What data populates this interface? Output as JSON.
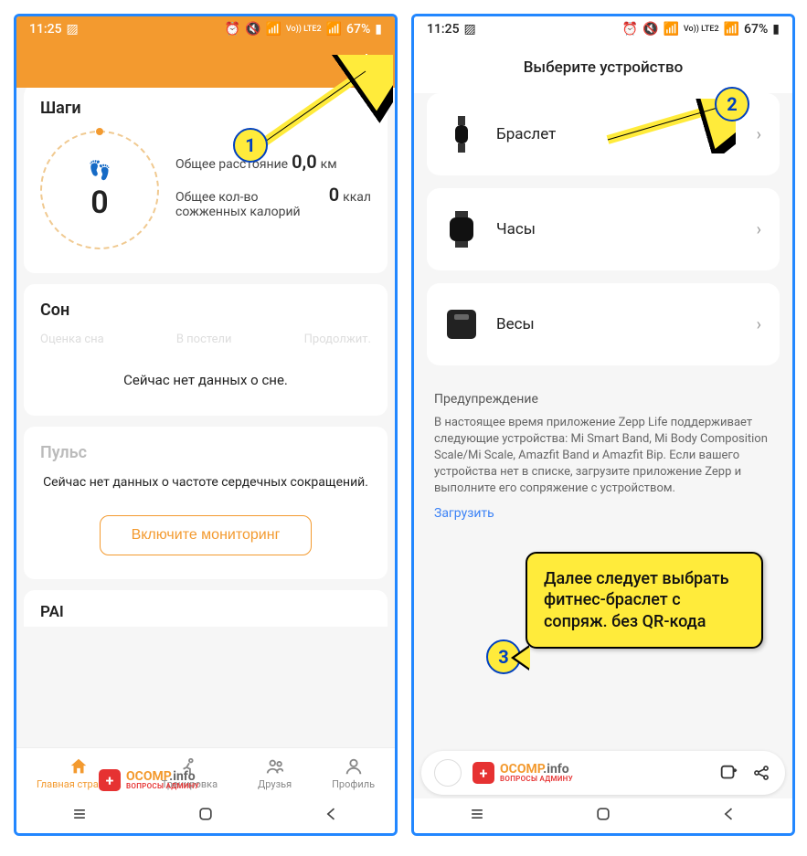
{
  "status": {
    "time": "11:25",
    "battery": "67%",
    "network": "Vo)) LTE2"
  },
  "left": {
    "steps": {
      "title": "Шаги",
      "count": "0",
      "distance_label": "Общее расстояние",
      "distance_value": "0,0",
      "distance_unit": "км",
      "calories_label": "Общее кол-во сожженных калорий",
      "calories_value": "0",
      "calories_unit": "ккал"
    },
    "sleep": {
      "title": "Сон",
      "sub1": "Оценка сна",
      "sub2": "В постели",
      "sub3": "Продолжит.",
      "no_data": "Сейчас нет данных о сне."
    },
    "pulse": {
      "title": "Пульс",
      "no_data": "Сейчас нет данных о частоте сердечных сокращений.",
      "button": "Включите мониторинг"
    },
    "pai": "PAI",
    "nav": {
      "home": "Главная страница",
      "workout": "Тренировка",
      "friends": "Друзья",
      "profile": "Профиль"
    }
  },
  "right": {
    "title": "Выберите устройство",
    "devices": {
      "band": "Браслет",
      "watch": "Часы",
      "scale": "Весы"
    },
    "warning": {
      "title": "Предупреждение",
      "text": "В настоящее время приложение Zepp Life поддерживает следующие устройства: Mi Smart Band, Mi Body Composition Scale/Mi Scale, Amazfit Band и Amazfit Bip. Если вашего устройства нет в списке, загрузите приложение Zepp и выполните его сопряжение с устройством.",
      "download": "Загрузить"
    }
  },
  "annotations": {
    "n1": "1",
    "n2": "2",
    "n3": "3",
    "callout": "Далее следует выбрать фитнес-браслет с сопряж. без QR-кода"
  },
  "ocomp": {
    "main": "OCOMP.info",
    "sub": "ВОПРОСЫ АДМИНУ"
  }
}
